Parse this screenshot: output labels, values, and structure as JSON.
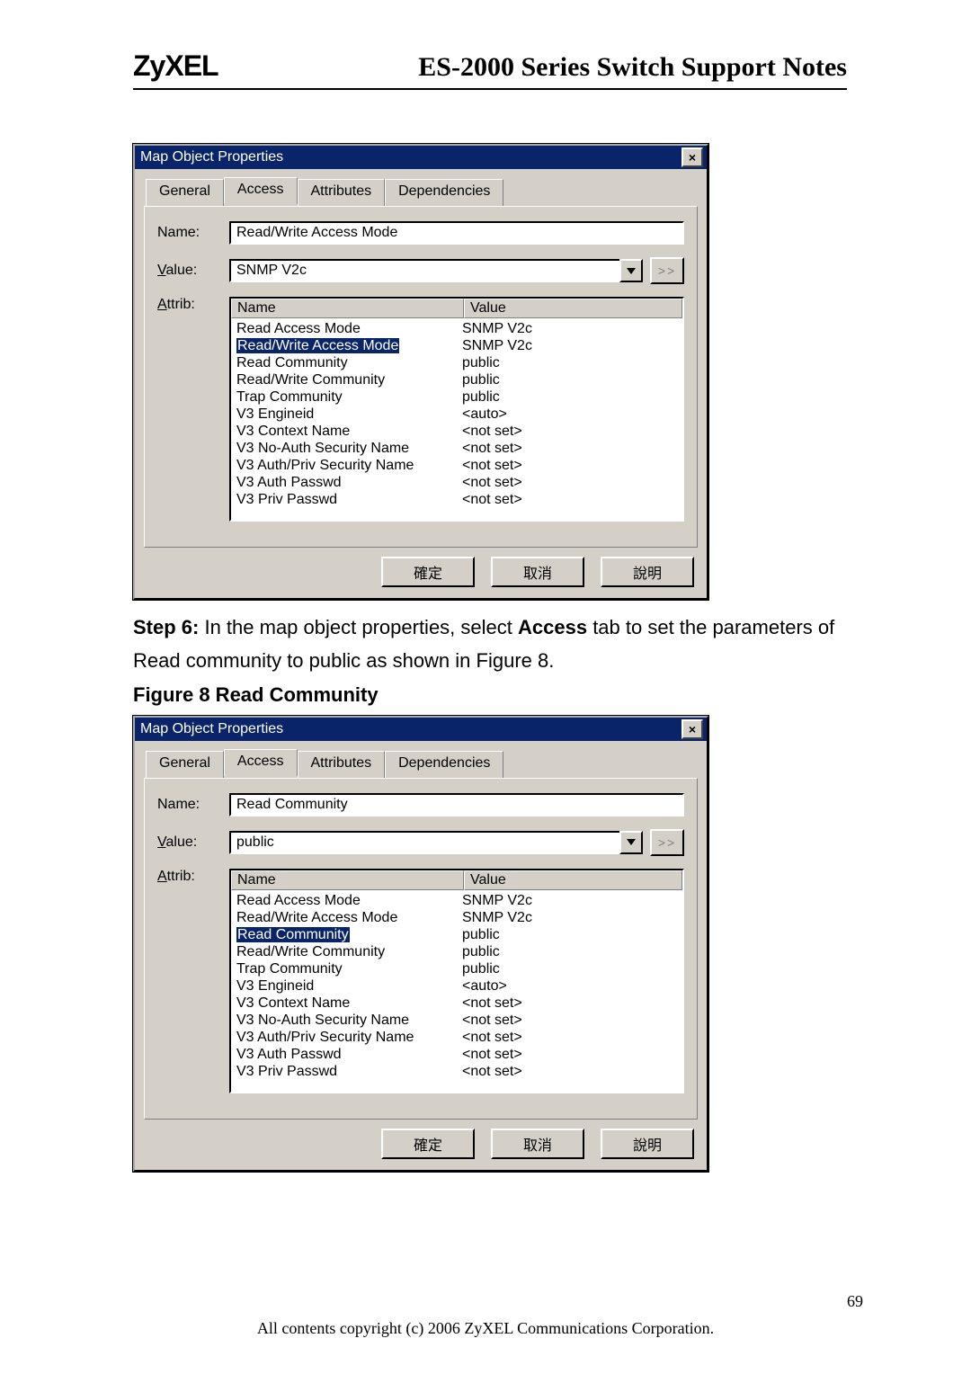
{
  "header": {
    "logo": "ZyXEL",
    "title": "ES-2000 Series Switch Support Notes"
  },
  "step_prefix": "Step 6: ",
  "step_body_1": "In the map object properties, select ",
  "step_bold_word": "Access",
  "step_body_2": " tab to set the parameters of Read community to public as shown in Figure 8.",
  "figure_caption": "Figure 8 Read Community",
  "dialog": {
    "title": "Map Object Properties",
    "close": "×",
    "tabs": {
      "general": "General",
      "access": "Access",
      "attributes": "Attributes",
      "dependencies": "Dependencies"
    },
    "labels": {
      "name": "Name:",
      "value": "Value:",
      "value_mnemonic": "V",
      "attrib": "Attrib:",
      "attrib_mnemonic": "A"
    },
    "extra_btn": ">>",
    "list_headers": {
      "name": "Name",
      "value": "Value"
    },
    "buttons": {
      "ok": "確定",
      "cancel": "取消",
      "help": "說明"
    }
  },
  "dialog1": {
    "name_value": "Read/Write Access Mode",
    "value_value": "SNMP V2c",
    "selected_index": 1
  },
  "dialog2": {
    "name_value": "Read Community",
    "value_value": "public",
    "selected_index": 2
  },
  "attrib_rows": [
    {
      "name": "Read Access Mode",
      "value": "SNMP V2c"
    },
    {
      "name": "Read/Write Access Mode",
      "value": "SNMP V2c"
    },
    {
      "name": "Read Community",
      "value": "public"
    },
    {
      "name": "Read/Write Community",
      "value": "public"
    },
    {
      "name": "Trap Community",
      "value": "public"
    },
    {
      "name": "V3 Engineid",
      "value": "<auto>"
    },
    {
      "name": "V3 Context Name",
      "value": "<not set>"
    },
    {
      "name": "V3 No-Auth Security Name",
      "value": "<not set>"
    },
    {
      "name": "V3 Auth/Priv Security Name",
      "value": "<not set>"
    },
    {
      "name": "V3 Auth Passwd",
      "value": "<not set>"
    },
    {
      "name": "V3 Priv Passwd",
      "value": "<not set>"
    }
  ],
  "footer": {
    "page": "69",
    "copyright": "All contents copyright (c) 2006 ZyXEL Communications Corporation."
  }
}
